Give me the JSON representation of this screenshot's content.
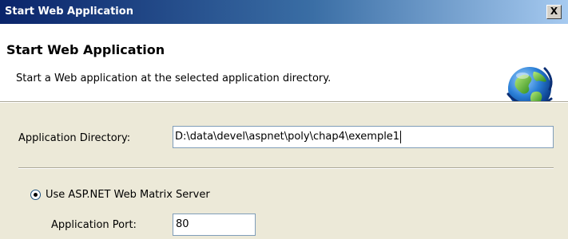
{
  "window": {
    "title": "Start Web Application",
    "close_label": "X"
  },
  "header": {
    "title": "Start Web Application",
    "subtitle": "Start a Web application at the selected application directory.",
    "icon": "globe-icon"
  },
  "form": {
    "directory_label": "Application Directory:",
    "directory_value": "D:\\data\\devel\\aspnet\\poly\\chap4\\exemple1",
    "server_option_label": "Use ASP.NET Web Matrix Server",
    "server_option_selected": true,
    "port_label": "Application Port:",
    "port_value": "80"
  },
  "colors": {
    "title_bar_start": "#0a246a",
    "title_bar_end": "#a6caf0",
    "dialog_background": "#ece9d8",
    "header_background": "#ffffff"
  }
}
